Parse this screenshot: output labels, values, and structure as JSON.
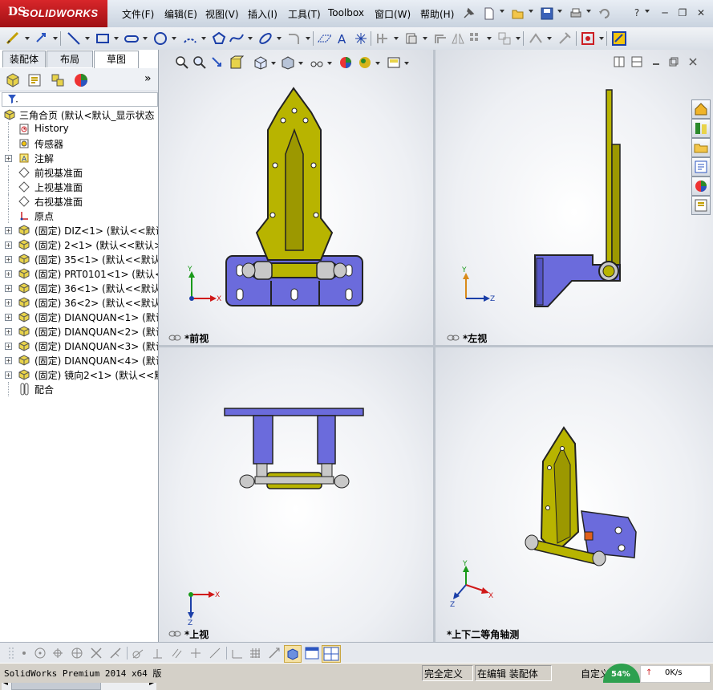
{
  "app": {
    "logo_prefix": "DS",
    "logo_text": "SOLIDWORKS"
  },
  "menu": [
    "文件(F)",
    "编辑(E)",
    "视图(V)",
    "插入(I)",
    "工具(T)",
    "Toolbox",
    "窗口(W)",
    "帮助(H)"
  ],
  "window_controls": [
    "?",
    "─",
    "❐",
    "✕"
  ],
  "feature_manager": {
    "tabs": [
      "装配体",
      "布局",
      "草图"
    ],
    "active_tab": 2,
    "expand_glyph": "»",
    "root_label": "三角合页  (默认<默认_显示状态",
    "items": [
      {
        "label": "History",
        "icon": "history-icon",
        "expandable": false
      },
      {
        "label": "传感器",
        "icon": "sensor-icon",
        "expandable": false
      },
      {
        "label": "注解",
        "icon": "annotation-icon",
        "expandable": true
      },
      {
        "label": "前视基准面",
        "icon": "plane-icon",
        "expandable": false
      },
      {
        "label": "上视基准面",
        "icon": "plane-icon",
        "expandable": false
      },
      {
        "label": "右视基准面",
        "icon": "plane-icon",
        "expandable": false
      },
      {
        "label": "原点",
        "icon": "origin-icon",
        "expandable": false
      },
      {
        "label": "(固定) DIZ<1> (默认<<默认>",
        "icon": "part-icon",
        "expandable": true
      },
      {
        "label": "(固定) 2<1> (默认<<默认>_显",
        "icon": "part-icon",
        "expandable": true
      },
      {
        "label": "(固定) 35<1> (默认<<默认>_",
        "icon": "part-icon",
        "expandable": true
      },
      {
        "label": "(固定) PRT0101<1> (默认<<默",
        "icon": "part-icon",
        "expandable": true
      },
      {
        "label": "(固定) 36<1> (默认<<默认>_",
        "icon": "part-icon",
        "expandable": true
      },
      {
        "label": "(固定) 36<2> (默认<<默认>_",
        "icon": "part-icon",
        "expandable": true
      },
      {
        "label": "(固定) DIANQUAN<1> (默认<<",
        "icon": "part-icon",
        "expandable": true
      },
      {
        "label": "(固定) DIANQUAN<2> (默认<<",
        "icon": "part-icon",
        "expandable": true
      },
      {
        "label": "(固定) DIANQUAN<3> (默认<<",
        "icon": "part-icon",
        "expandable": true
      },
      {
        "label": "(固定) DIANQUAN<4> (默认<<",
        "icon": "part-icon",
        "expandable": true
      },
      {
        "label": "(固定) 镜向2<1> (默认<<默认",
        "icon": "part-icon",
        "expandable": true
      },
      {
        "label": "配合",
        "icon": "mates-icon",
        "expandable": false
      }
    ]
  },
  "viewports": {
    "front": {
      "label": "*前视",
      "axes": [
        "Y",
        "X"
      ]
    },
    "left": {
      "label": "*左视",
      "axes": [
        "Y",
        "Z"
      ]
    },
    "top": {
      "label": "*上视",
      "axes": [
        "X",
        "Z"
      ]
    },
    "iso": {
      "label": "*上下二等角轴测",
      "axes": [
        "Y",
        "X",
        "Z"
      ]
    }
  },
  "status_bar": {
    "product": "SolidWorks Premium 2014 x64 版",
    "fully_defined": "完全定义",
    "editing": "在编辑 装配体",
    "custom": "自定义",
    "net_percent": "54%",
    "net_speed": "0K/s"
  },
  "colors": {
    "hinge_yellow": "#b8b400",
    "bracket_blue": "#6b6bdc",
    "steel": "#c8c8c8",
    "accent_red": "#cc1f24"
  }
}
